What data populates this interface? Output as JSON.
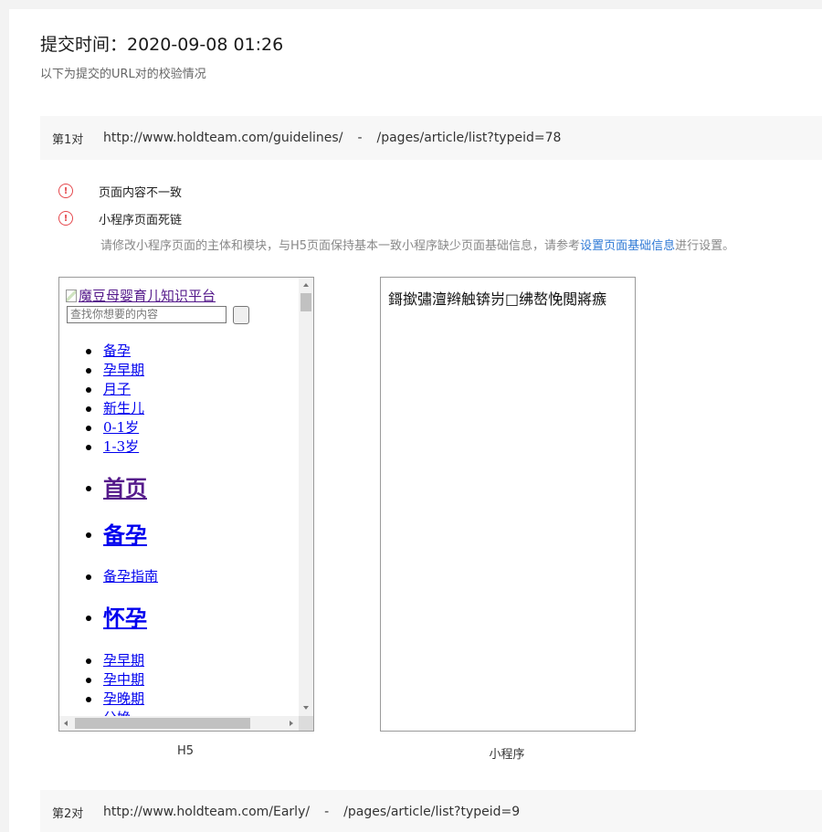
{
  "header": {
    "title": "提交时间：2020-09-08 01:26",
    "subtitle": "以下为提交的URL对的校验情况"
  },
  "pairs": [
    {
      "index": "第1对",
      "h5_url": "http://www.holdteam.com/guidelines/",
      "separator": "-",
      "mp_path": "/pages/article/list?typeid=78"
    },
    {
      "index": "第2对",
      "h5_url": "http://www.holdteam.com/Early/",
      "separator": "-",
      "mp_path": "/pages/article/list?typeid=9"
    }
  ],
  "issues": [
    {
      "text": "页面内容不一致",
      "icon": "warning-circle-icon"
    },
    {
      "text": "小程序页面死链",
      "icon": "warning-circle-icon"
    }
  ],
  "hint": {
    "prefix": "请修改小程序页面的主体和模块，与H5页面保持基本一致小程序缺少页面基础信息，请参考",
    "link": "设置页面基础信息",
    "suffix": "进行设置。"
  },
  "h5_preview": {
    "logo_alt": "魔豆母婴育儿知识平台",
    "search_placeholder": "查找你想要的内容",
    "nav_small_1": [
      "备孕",
      "孕早期",
      "月子",
      "新生儿",
      "0-1岁",
      "1-3岁"
    ],
    "nav_big_1": [
      "首页",
      "备孕"
    ],
    "nav_small_2": [
      "备孕指南"
    ],
    "nav_big_2": [
      "怀孕"
    ],
    "nav_small_3": [
      "孕早期",
      "孕中期",
      "孕晚期",
      "分娩"
    ]
  },
  "mp_preview": {
    "garbled_text": "鎶撳彇澶辫触锛岃□绋嶅悗閲嶈瘯"
  },
  "captions": {
    "h5": "H5",
    "mp": "小程序"
  },
  "colors": {
    "warning": "#e5484d",
    "link": "#2f7ad6"
  }
}
